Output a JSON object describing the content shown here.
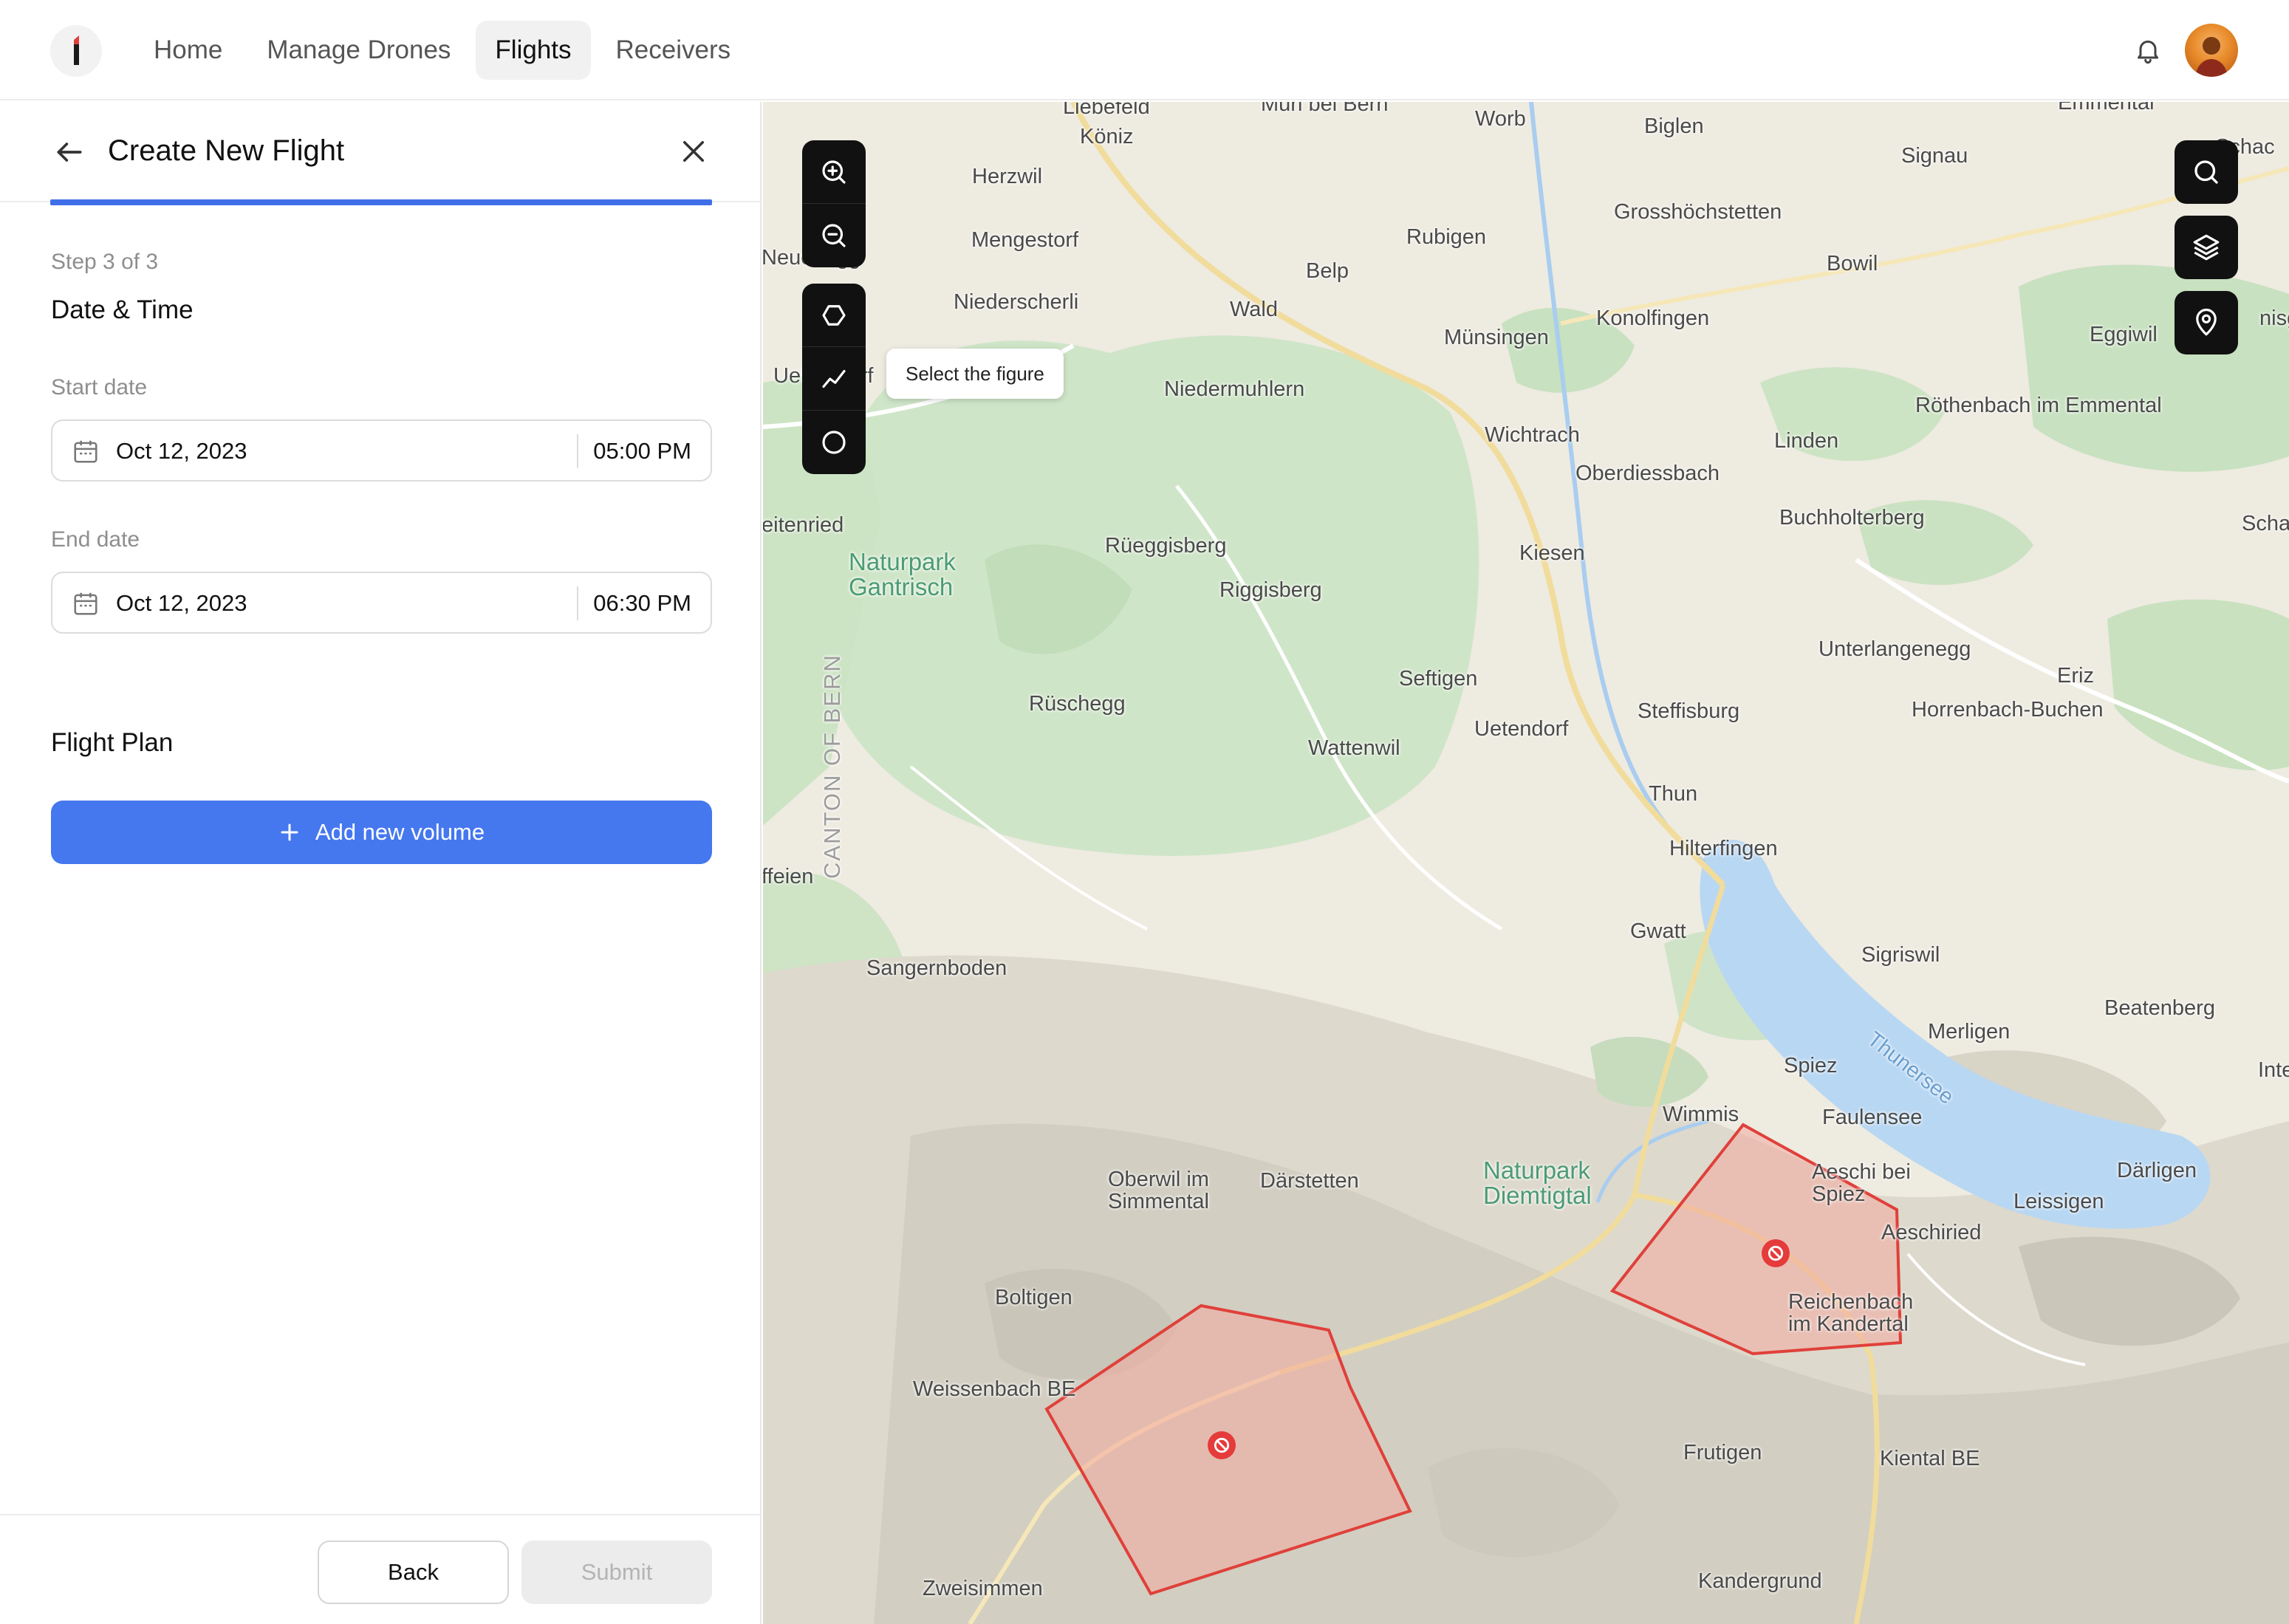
{
  "nav": {
    "items": [
      "Home",
      "Manage Drones",
      "Flights",
      "Receivers"
    ],
    "active": "Flights"
  },
  "panel": {
    "title": "Create New Flight",
    "step": "Step 3 of 3",
    "section": "Date & Time",
    "start_label": "Start date",
    "start_date": "Oct 12, 2023",
    "start_time": "05:00 PM",
    "end_label": "End date",
    "end_date": "Oct 12, 2023",
    "end_time": "06:30 PM",
    "plan_title": "Flight Plan",
    "add_volume": "Add new volume",
    "back_label": "Back",
    "submit_label": "Submit"
  },
  "map": {
    "tooltip": "Select the figure",
    "places": [
      "Liebefeld",
      "Muri bei Bern",
      "Worb",
      "Biglen",
      "Emmental",
      "Schac",
      "Köniz",
      "Signau",
      "Herzwil",
      "Grosshöchstetten",
      "Rubigen",
      "Mengestorf",
      "Neuenegg",
      "Belp",
      "Bowil",
      "Wald",
      "Niederscherli",
      "Konolfingen",
      "Münsingen",
      "Eggiwil",
      "nisgu",
      "Ueberstorf",
      "Niedermuhlern",
      "Röthenbach im Emmental",
      "Wichtrach",
      "Linden",
      "Oberdiessbach",
      "Buchholterberg",
      "eitenried",
      "Schangnau",
      "Naturpark Gantrisch",
      "Rüeggisberg",
      "Kiesen",
      "Riggisberg",
      "Unterlangenegg",
      "Seftigen",
      "Eriz",
      "Rüschegg",
      "Steffisburg",
      "Horrenbach-Buchen",
      "Uetendorf",
      "Wattenwil",
      "CANTON OF BERN",
      "Thun",
      "Hilterfingen",
      "ffeien",
      "Gwatt",
      "Sigriswil",
      "Sangernboden",
      "Beatenberg",
      "Merligen",
      "Thunersee",
      "Spiez",
      "Wimmis",
      "Faulensee",
      "Inte",
      "Oberwil im Simmental",
      "Därstetten",
      "Naturpark Diemtigtal",
      "Aeschi bei Spiez",
      "Därligen",
      "Leissigen",
      "Aeschiried",
      "Boltigen",
      "Reichenbach im Kandertal",
      "Weissenbach BE",
      "Frutigen",
      "Kiental BE",
      "Zweisimmen",
      "Kandergrund"
    ]
  },
  "icons": {
    "nav": [
      "logo-icon",
      "bell-icon"
    ],
    "map_tools": [
      "zoom-in-icon",
      "zoom-out-icon",
      "polygon-icon",
      "polyline-icon",
      "circle-icon"
    ],
    "map_right": [
      "search-icon",
      "layers-icon",
      "location-pin-icon"
    ],
    "zone": "no-fly-icon"
  },
  "colors": {
    "accent": "#4577ef",
    "nofly_stroke": "#e0403a",
    "nofly_fill": "#f3aaa0"
  }
}
